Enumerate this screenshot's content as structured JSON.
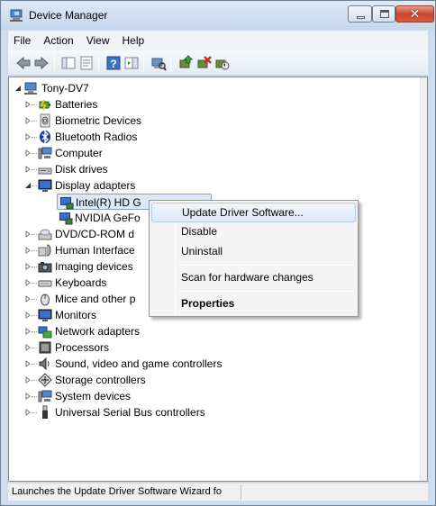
{
  "window": {
    "title": "Device Manager"
  },
  "menu": [
    "File",
    "Action",
    "View",
    "Help"
  ],
  "toolbar": {
    "buttons": [
      "back-icon",
      "forward-icon",
      "show-hide-console-tree-icon",
      "properties-icon",
      "help-icon",
      "show-action-pane-icon",
      "scan-hardware-icon",
      "update-driver-icon",
      "uninstall-icon",
      "disable-icon"
    ]
  },
  "tree": {
    "root": "Tony-DV7",
    "nodes": [
      {
        "label": "Batteries",
        "icon": "battery-icon"
      },
      {
        "label": "Biometric Devices",
        "icon": "fingerprint-icon"
      },
      {
        "label": "Bluetooth Radios",
        "icon": "bluetooth-icon"
      },
      {
        "label": "Computer",
        "icon": "computer-icon"
      },
      {
        "label": "Disk drives",
        "icon": "disk-drive-icon"
      },
      {
        "label": "Display adapters",
        "icon": "monitor-icon",
        "expanded": true,
        "children": [
          {
            "label": "Intel(R) HD G",
            "icon": "display-adapter-icon",
            "selected": true
          },
          {
            "label": "NVIDIA GeFo",
            "icon": "display-adapter-icon"
          }
        ]
      },
      {
        "label": "DVD/CD-ROM d",
        "icon": "dvd-drive-icon"
      },
      {
        "label": "Human Interface",
        "icon": "hid-icon"
      },
      {
        "label": "Imaging devices",
        "icon": "camera-icon"
      },
      {
        "label": "Keyboards",
        "icon": "keyboard-icon"
      },
      {
        "label": "Mice and other p",
        "icon": "mouse-icon"
      },
      {
        "label": "Monitors",
        "icon": "monitor-icon"
      },
      {
        "label": "Network adapters",
        "icon": "network-adapter-icon"
      },
      {
        "label": "Processors",
        "icon": "processor-icon"
      },
      {
        "label": "Sound, video and game controllers",
        "icon": "speaker-icon"
      },
      {
        "label": "Storage controllers",
        "icon": "storage-controller-icon"
      },
      {
        "label": "System devices",
        "icon": "system-device-icon"
      },
      {
        "label": "Universal Serial Bus controllers",
        "icon": "usb-icon"
      }
    ]
  },
  "context_menu": {
    "items": [
      "Update Driver Software...",
      "Disable",
      "Uninstall",
      "Scan for hardware changes",
      "Properties"
    ],
    "hovered": "Update Driver Software..."
  },
  "status": {
    "text": "Launches the Update Driver Software Wizard fo"
  }
}
